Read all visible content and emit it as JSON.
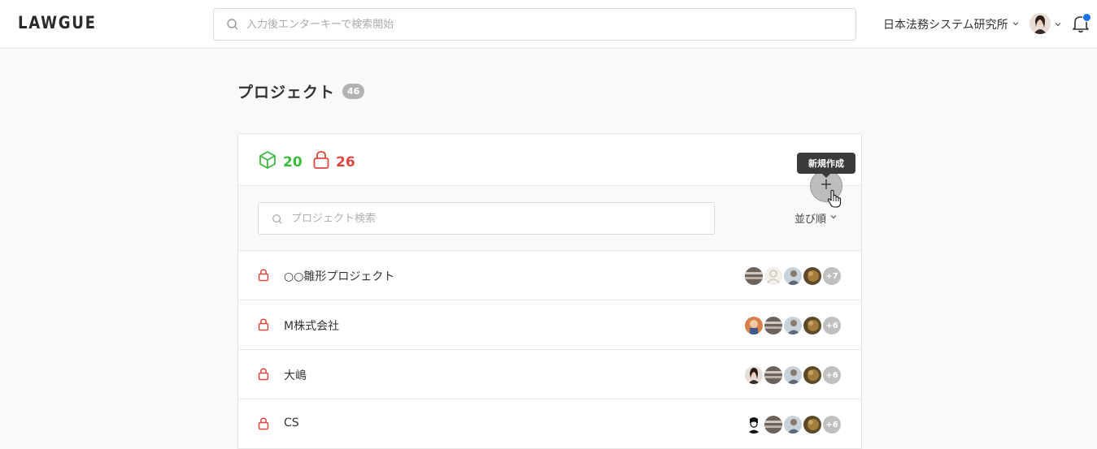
{
  "header": {
    "logo": "LAWGUE",
    "search_placeholder": "入力後エンターキーで検索開始",
    "org_name": "日本法務システム研究所"
  },
  "page": {
    "title": "プロジェクト",
    "total_count": "46"
  },
  "stats": {
    "open_count": "20",
    "locked_count": "26"
  },
  "toolbar": {
    "search_placeholder": "プロジェクト検索",
    "sort_label": "並び順",
    "add_tooltip": "新規作成"
  },
  "projects": [
    {
      "name": "○○雛形プロジェクト",
      "more_members": "+7"
    },
    {
      "name": "M株式会社",
      "more_members": "+6"
    },
    {
      "name": "大嶋",
      "more_members": "+6"
    },
    {
      "name": "CS",
      "more_members": "+6"
    }
  ],
  "colors": {
    "open": "#3cba3c",
    "locked": "#e0463c",
    "notification": "#1a73e8"
  }
}
